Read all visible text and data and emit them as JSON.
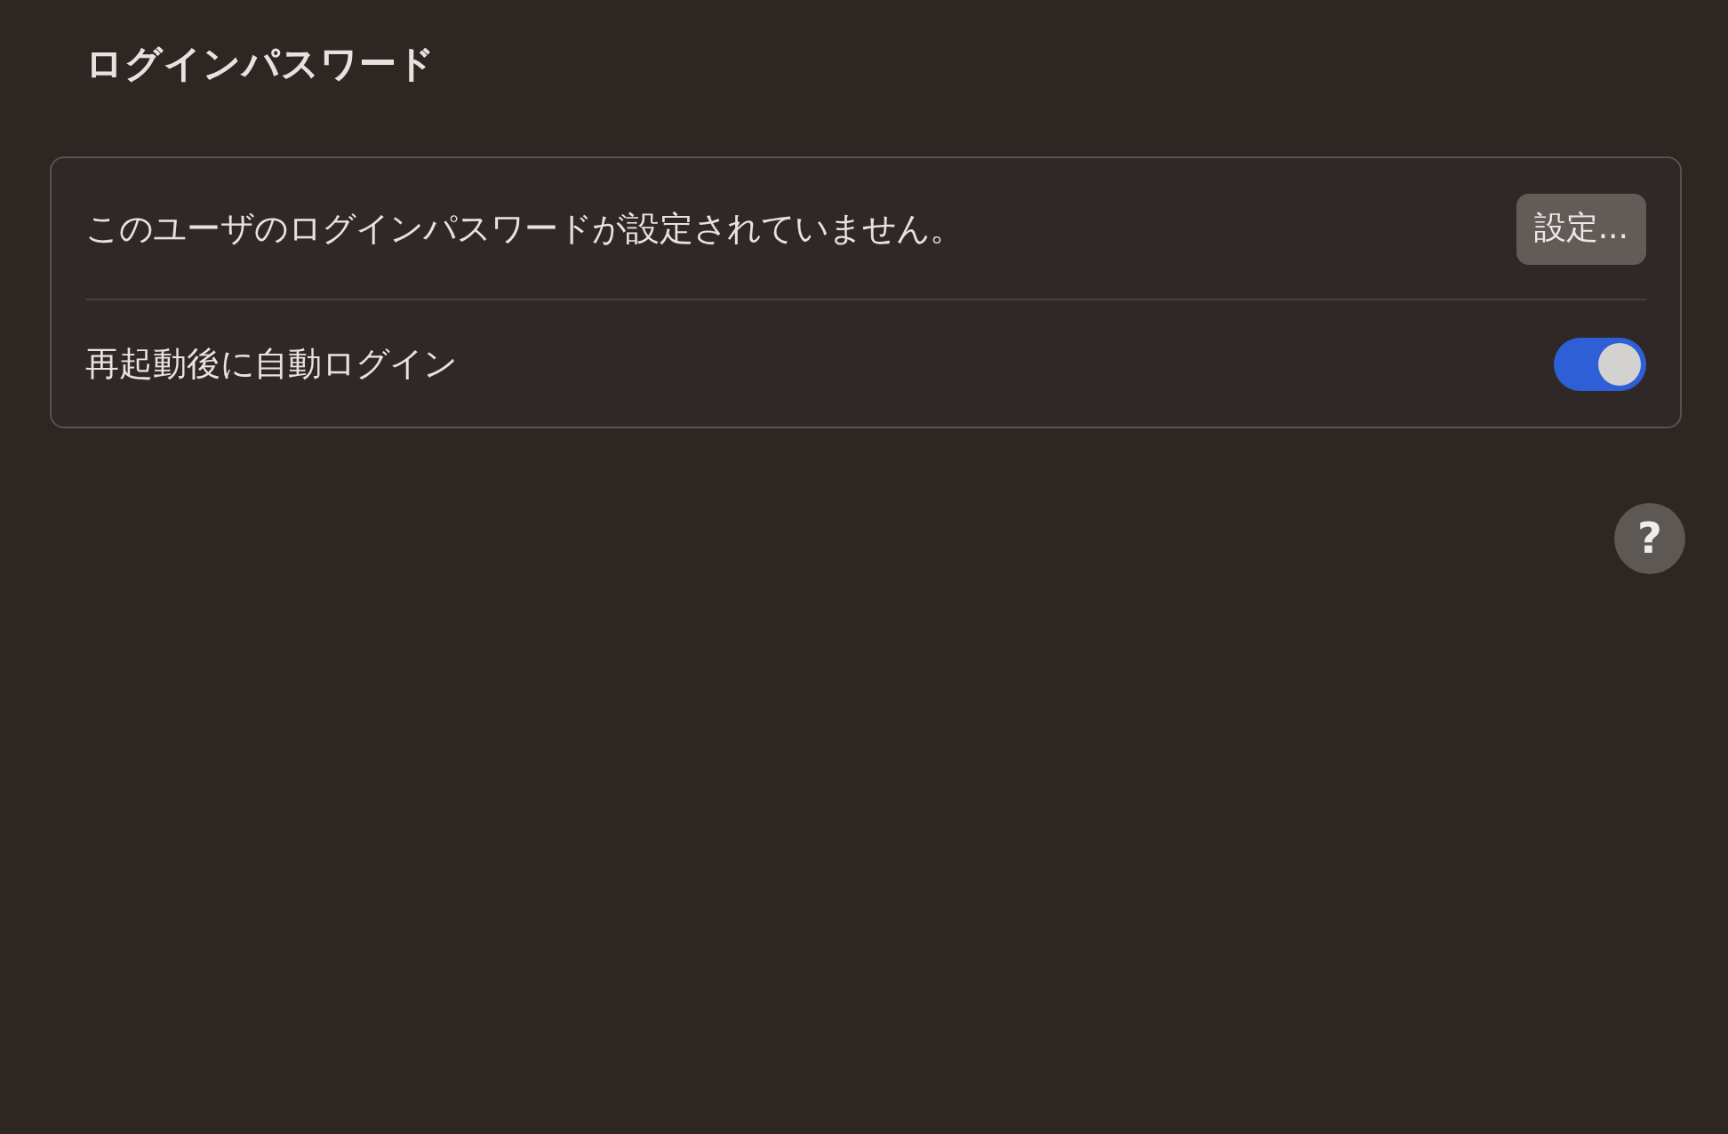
{
  "section": {
    "title": "ログインパスワード"
  },
  "rows": [
    {
      "kind": "button",
      "label": "このユーザのログインパスワードが設定されていません。",
      "button": "設定..."
    },
    {
      "kind": "toggle",
      "label": "再起動後に自動ログイン",
      "on": true
    }
  ],
  "help": "?"
}
